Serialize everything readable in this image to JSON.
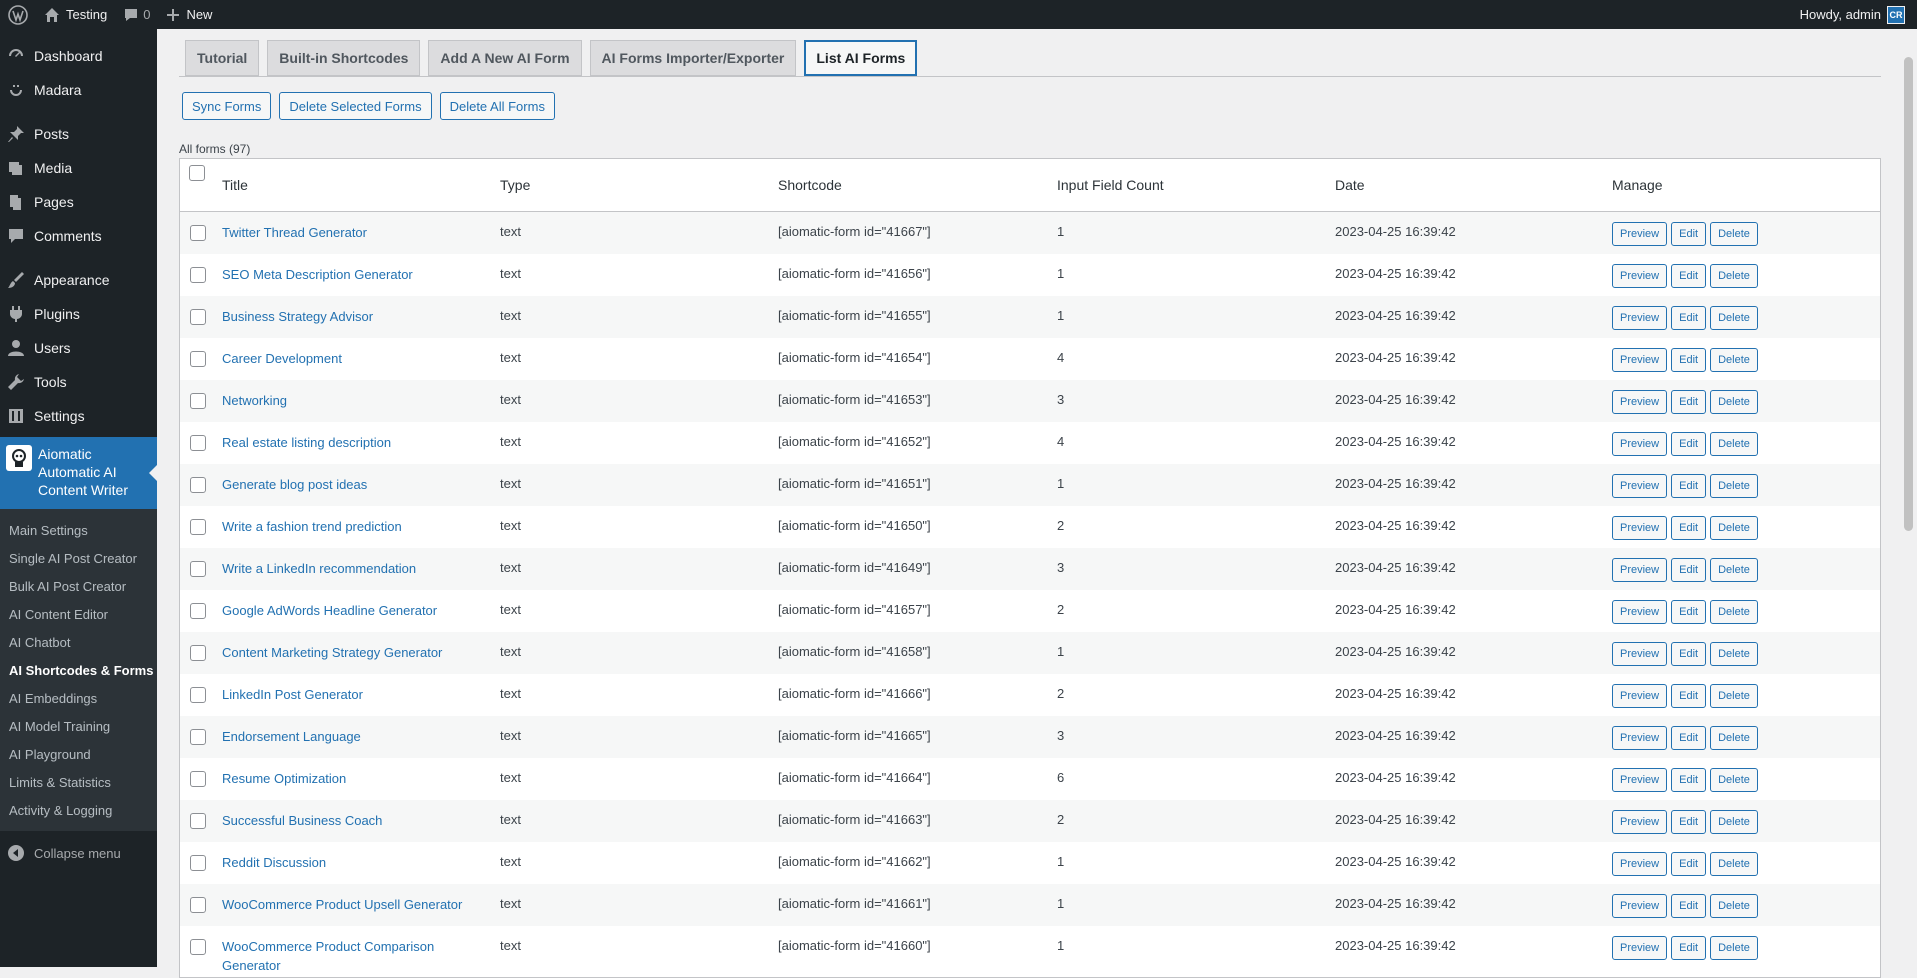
{
  "adminbar": {
    "site_name": "Testing",
    "comments_count": "0",
    "new_label": "New",
    "greeting": "Howdy, admin",
    "avatar_initials": "CR"
  },
  "sidebar": {
    "items": [
      {
        "label": "Dashboard",
        "icon": "dashboard-icon"
      },
      {
        "label": "Madara",
        "icon": "madara-icon"
      },
      {
        "label": "Posts",
        "icon": "posts-icon"
      },
      {
        "label": "Media",
        "icon": "media-icon"
      },
      {
        "label": "Pages",
        "icon": "pages-icon"
      },
      {
        "label": "Comments",
        "icon": "comments-icon"
      },
      {
        "label": "Appearance",
        "icon": "appearance-icon"
      },
      {
        "label": "Plugins",
        "icon": "plugins-icon"
      },
      {
        "label": "Users",
        "icon": "users-icon"
      },
      {
        "label": "Tools",
        "icon": "tools-icon"
      },
      {
        "label": "Settings",
        "icon": "settings-icon"
      }
    ],
    "active": {
      "label_line1": "Aiomatic",
      "label_line2": "Automatic AI",
      "label_line3": "Content Writer"
    },
    "submenu": [
      "Main Settings",
      "Single AI Post Creator",
      "Bulk AI Post Creator",
      "AI Content Editor",
      "AI Chatbot",
      "AI Shortcodes & Forms",
      "AI Embeddings",
      "AI Model Training",
      "AI Playground",
      "Limits & Statistics",
      "Activity & Logging"
    ],
    "collapse_label": "Collapse menu"
  },
  "tabs": [
    "Tutorial",
    "Built-in Shortcodes",
    "Add A New AI Form",
    "AI Forms Importer/Exporter",
    "List AI Forms"
  ],
  "actions": {
    "sync": "Sync Forms",
    "delete_selected": "Delete Selected Forms",
    "delete_all": "Delete All Forms"
  },
  "list": {
    "count_label": "All forms (97)",
    "headers": {
      "title": "Title",
      "type": "Type",
      "shortcode": "Shortcode",
      "count": "Input Field Count",
      "date": "Date",
      "manage": "Manage"
    },
    "manage_buttons": {
      "preview": "Preview",
      "edit": "Edit",
      "delete": "Delete"
    },
    "rows": [
      {
        "title": "Twitter Thread Generator",
        "type": "text",
        "shortcode": "[aiomatic-form id=\"41667\"]",
        "count": "1",
        "date": "2023-04-25 16:39:42"
      },
      {
        "title": "SEO Meta Description Generator",
        "type": "text",
        "shortcode": "[aiomatic-form id=\"41656\"]",
        "count": "1",
        "date": "2023-04-25 16:39:42"
      },
      {
        "title": "Business Strategy Advisor",
        "type": "text",
        "shortcode": "[aiomatic-form id=\"41655\"]",
        "count": "1",
        "date": "2023-04-25 16:39:42"
      },
      {
        "title": "Career Development",
        "type": "text",
        "shortcode": "[aiomatic-form id=\"41654\"]",
        "count": "4",
        "date": "2023-04-25 16:39:42"
      },
      {
        "title": "Networking",
        "type": "text",
        "shortcode": "[aiomatic-form id=\"41653\"]",
        "count": "3",
        "date": "2023-04-25 16:39:42"
      },
      {
        "title": "Real estate listing description",
        "type": "text",
        "shortcode": "[aiomatic-form id=\"41652\"]",
        "count": "4",
        "date": "2023-04-25 16:39:42"
      },
      {
        "title": "Generate blog post ideas",
        "type": "text",
        "shortcode": "[aiomatic-form id=\"41651\"]",
        "count": "1",
        "date": "2023-04-25 16:39:42"
      },
      {
        "title": "Write a fashion trend prediction",
        "type": "text",
        "shortcode": "[aiomatic-form id=\"41650\"]",
        "count": "2",
        "date": "2023-04-25 16:39:42"
      },
      {
        "title": "Write a LinkedIn recommendation",
        "type": "text",
        "shortcode": "[aiomatic-form id=\"41649\"]",
        "count": "3",
        "date": "2023-04-25 16:39:42"
      },
      {
        "title": "Google AdWords Headline Generator",
        "type": "text",
        "shortcode": "[aiomatic-form id=\"41657\"]",
        "count": "2",
        "date": "2023-04-25 16:39:42"
      },
      {
        "title": "Content Marketing Strategy Generator",
        "type": "text",
        "shortcode": "[aiomatic-form id=\"41658\"]",
        "count": "1",
        "date": "2023-04-25 16:39:42"
      },
      {
        "title": "LinkedIn Post Generator",
        "type": "text",
        "shortcode": "[aiomatic-form id=\"41666\"]",
        "count": "2",
        "date": "2023-04-25 16:39:42"
      },
      {
        "title": "Endorsement Language",
        "type": "text",
        "shortcode": "[aiomatic-form id=\"41665\"]",
        "count": "3",
        "date": "2023-04-25 16:39:42"
      },
      {
        "title": "Resume Optimization",
        "type": "text",
        "shortcode": "[aiomatic-form id=\"41664\"]",
        "count": "6",
        "date": "2023-04-25 16:39:42"
      },
      {
        "title": "Successful Business Coach",
        "type": "text",
        "shortcode": "[aiomatic-form id=\"41663\"]",
        "count": "2",
        "date": "2023-04-25 16:39:42"
      },
      {
        "title": "Reddit Discussion",
        "type": "text",
        "shortcode": "[aiomatic-form id=\"41662\"]",
        "count": "1",
        "date": "2023-04-25 16:39:42"
      },
      {
        "title": "WooCommerce Product Upsell Generator",
        "type": "text",
        "shortcode": "[aiomatic-form id=\"41661\"]",
        "count": "1",
        "date": "2023-04-25 16:39:42"
      },
      {
        "title": "WooCommerce Product Comparison Generator",
        "type": "text",
        "shortcode": "[aiomatic-form id=\"41660\"]",
        "count": "1",
        "date": "2023-04-25 16:39:42"
      }
    ]
  }
}
